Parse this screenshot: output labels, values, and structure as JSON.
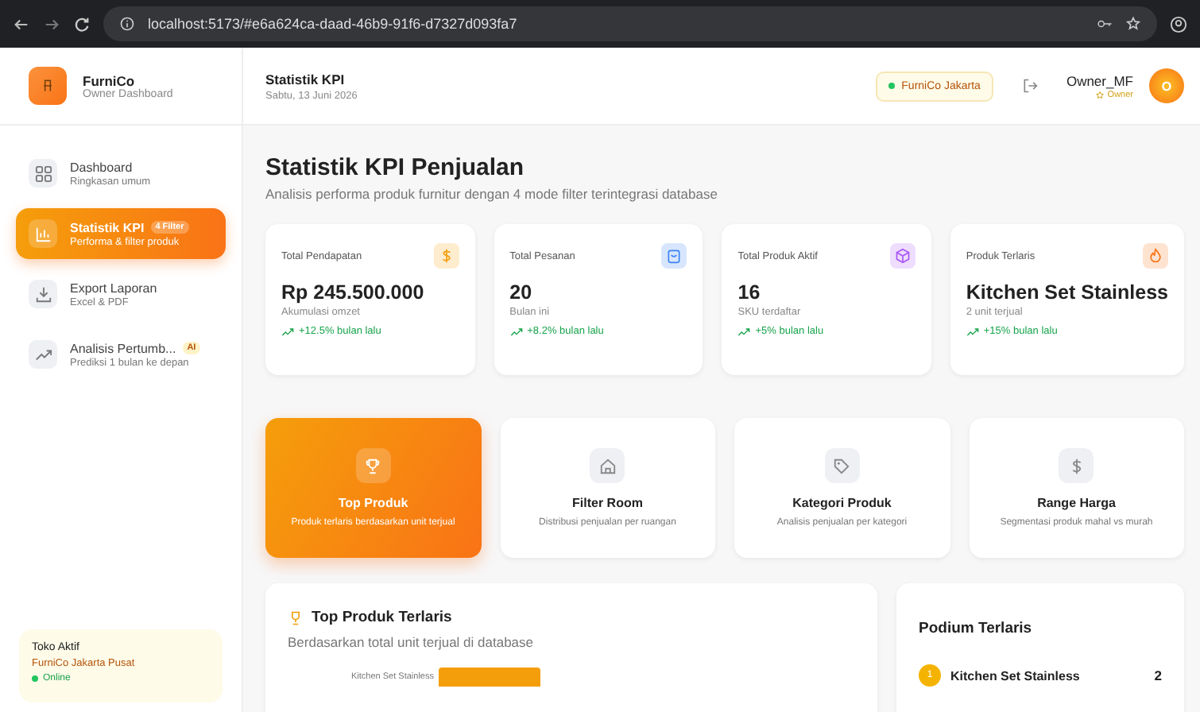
{
  "browser": {
    "url": "localhost:5173/#e6a624ca-daad-46b9-91f6-d7327d093fa7"
  },
  "sidebar": {
    "brand": "FurniCo",
    "brand_sub": "Owner Dashboard",
    "items": [
      {
        "kind": "grid",
        "title": "Dashboard",
        "subtitle": "Ringkasan umum",
        "selected": false
      },
      {
        "kind": "chart",
        "title": "Statistik KPI",
        "badge": "4 Filter",
        "subtitle": "Performa & filter produk",
        "selected": true
      },
      {
        "kind": "download",
        "title": "Export Laporan",
        "subtitle": "Excel & PDF",
        "selected": false
      },
      {
        "kind": "trend",
        "title": "Analisis Pertumb...",
        "badge": "AI",
        "subtitle": "Prediksi 1 bulan ke depan",
        "selected": false
      }
    ],
    "store": {
      "label": "Toko Aktif",
      "name": "FurniCo Jakarta Pusat",
      "status": "Online"
    }
  },
  "header": {
    "title": "Statistik KPI",
    "date": "Sabtu, 13 Juni 2026",
    "store_chip": "FurniCo Jakarta",
    "user_name": "Owner_MF",
    "user_role": "Owner",
    "avatar": "O"
  },
  "page": {
    "title": "Statistik KPI Penjualan",
    "subtitle": "Analisis performa produk furnitur dengan 4 mode filter terintegrasi database"
  },
  "kpis": [
    {
      "label": "Total Pendapatan",
      "kind": "dollar",
      "color": "#f59e0b",
      "value": "Rp 245.500.000",
      "note": "Akumulasi omzet",
      "trend": "+12.5% bulan lalu"
    },
    {
      "label": "Total Pesanan",
      "kind": "bag",
      "color": "#3b82f6",
      "value": "20",
      "note": "Bulan ini",
      "trend": "+8.2% bulan lalu"
    },
    {
      "label": "Total Produk Aktif",
      "kind": "box",
      "color": "#a855f7",
      "value": "16",
      "note": "SKU terdaftar",
      "trend": "+5% bulan lalu"
    },
    {
      "label": "Produk Terlaris",
      "kind": "flame",
      "color": "#f97316",
      "value": "Kitchen Set Stainless",
      "note": "2 unit terjual",
      "trend": "+15% bulan lalu"
    }
  ],
  "modes": [
    {
      "kind": "trophy",
      "title": "Top Produk",
      "desc": "Produk terlaris berdasarkan unit terjual",
      "selected": true
    },
    {
      "kind": "home",
      "title": "Filter Room",
      "desc": "Distribusi penjualan per ruangan",
      "selected": false
    },
    {
      "kind": "tag",
      "title": "Kategori Produk",
      "desc": "Analisis penjualan per kategori",
      "selected": false
    },
    {
      "kind": "dollar",
      "title": "Range Harga",
      "desc": "Segmentasi produk mahal vs murah",
      "selected": false
    }
  ],
  "top_products": {
    "title": "Top Produk Terlaris",
    "subtitle": "Berdasarkan total unit terjual di database",
    "bar_label": "Kitchen Set Stainless"
  },
  "podium": {
    "title": "Podium Terlaris",
    "items": [
      {
        "rank": "1",
        "name": "Kitchen Set Stainless",
        "count": "2"
      }
    ]
  }
}
